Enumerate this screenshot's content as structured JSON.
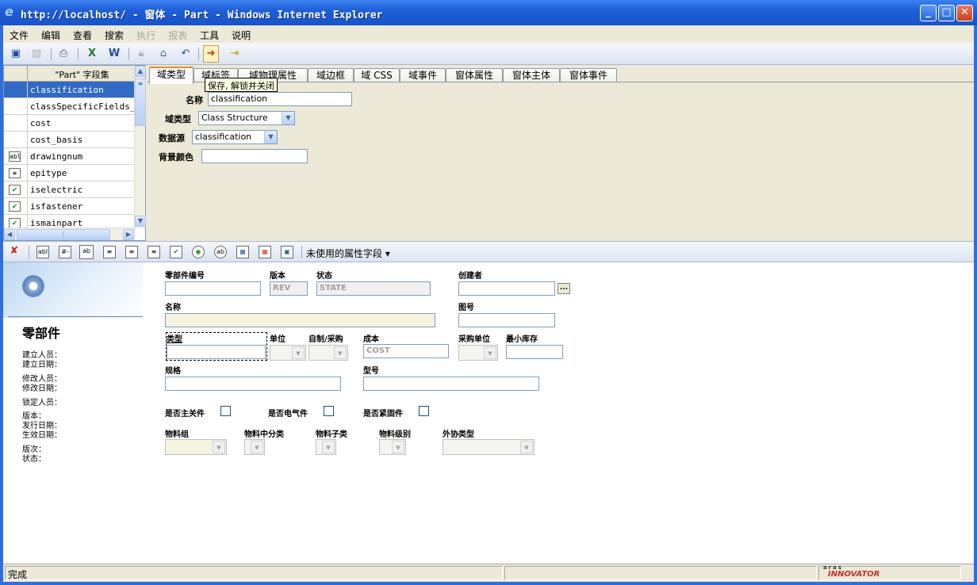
{
  "window": {
    "title": "http://localhost/ - 窗体 - Part - Windows Internet Explorer",
    "minimize": "_",
    "maximize": "□",
    "close": "✕"
  },
  "menu": [
    {
      "label": "文件",
      "enabled": true
    },
    {
      "label": "编辑",
      "enabled": true
    },
    {
      "label": "查看",
      "enabled": true
    },
    {
      "label": "搜索",
      "enabled": true
    },
    {
      "label": "执行",
      "enabled": false
    },
    {
      "label": "报表",
      "enabled": false
    },
    {
      "label": "工具",
      "enabled": true
    },
    {
      "label": "说明",
      "enabled": true
    }
  ],
  "toolbar": {
    "icons": [
      "save-icon",
      "discard-icon",
      "print-icon",
      "export-excel-icon",
      "export-word-icon",
      "lock-icon",
      "unlock-icon",
      "undo-icon",
      "save-unlock-close-icon",
      "exit-icon"
    ],
    "tooltip": "保存, 解锁并关闭"
  },
  "field_list": {
    "header": "\"Part\" 字段集",
    "rows": [
      {
        "icon": "",
        "name": "classification",
        "selected": true
      },
      {
        "icon": "",
        "name": "classSpecificFields_..."
      },
      {
        "icon": "",
        "name": "cost"
      },
      {
        "icon": "",
        "name": "cost_basis"
      },
      {
        "icon": "abl",
        "name": "drawingnum"
      },
      {
        "icon": "≡",
        "name": "epitype"
      },
      {
        "icon": "✔",
        "name": "iselectric"
      },
      {
        "icon": "✔",
        "name": "isfastener"
      },
      {
        "icon": "✔",
        "name": "ismainpart"
      }
    ]
  },
  "tabs": [
    "域类型",
    "域标签",
    "域物理属性",
    "域边框",
    "域 CSS",
    "域事件",
    "窗体属性",
    "窗体主体",
    "窗体事件"
  ],
  "field_props": {
    "name_label": "名称",
    "name_value": "classification",
    "type_label": "域类型",
    "type_value": "Class Structure",
    "datasource_label": "数据源",
    "datasource_value": "classification",
    "bgcolor_label": "背景颜色",
    "bgcolor_value": ""
  },
  "toolbar2": {
    "icon_labels": [
      "abl",
      "#-",
      "ab",
      "≡",
      "≡",
      "≡",
      "✔",
      "◉",
      "ab",
      "▦",
      "▦",
      "▣"
    ],
    "unused_label": "未使用的属性字段 ▾"
  },
  "form": {
    "item_title": "零部件",
    "meta": [
      "建立人员：",
      "建立日期：",
      "修改人员：",
      "修改日期：",
      "锁定人员：",
      "版本：",
      "发行日期：",
      "生效日期：",
      "版次：",
      "状态："
    ],
    "labels": {
      "item_number": "零部件编号",
      "revision": "版本",
      "state": "状态",
      "creator": "创建者",
      "name": "名称",
      "drawing_no": "图号",
      "type": "类型",
      "unit": "单位",
      "make_buy": "自制/采购",
      "cost": "成本",
      "purchase_unit": "采购单位",
      "min_stock": "最小库存",
      "spec": "规格",
      "model": "型号",
      "is_main": "是否主关件",
      "is_electric": "是否电气件",
      "is_fastener": "是否紧固件",
      "material_group": "物料组",
      "material_mid": "物料中分类",
      "material_sub": "物料子类",
      "material_level": "物料级别",
      "outsource_type": "外协类型"
    },
    "placeholders": {
      "revision": "REV",
      "state": "STATE",
      "cost": "COST"
    },
    "creator_button": "..."
  },
  "status": {
    "text": "完成",
    "brand_top": "aras",
    "brand_bottom": "INNOVATOR"
  }
}
